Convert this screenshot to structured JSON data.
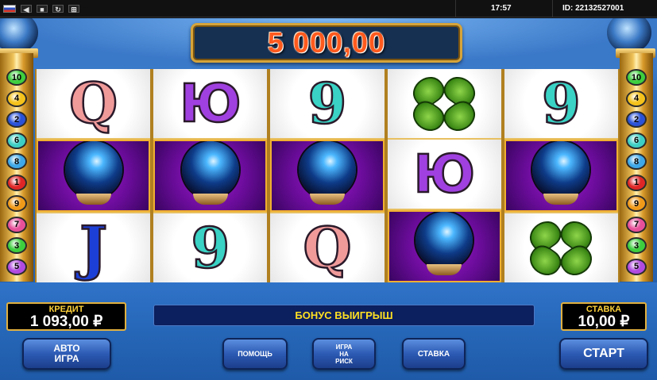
{
  "topbar": {
    "time": "17:57",
    "id_text": "ID: 22132527001",
    "icons": [
      "russia-flag-icon",
      "speaker-icon",
      "fullscreen-icon",
      "refresh-icon",
      "settings-icon"
    ]
  },
  "jackpot": {
    "value": "5 000,00"
  },
  "paylines_left": [
    {
      "num": "10",
      "color": "#3ecf3e"
    },
    {
      "num": "4",
      "color": "#f4c21a"
    },
    {
      "num": "2",
      "color": "#2a52d8"
    },
    {
      "num": "6",
      "color": "#3ecfc4"
    },
    {
      "num": "8",
      "color": "#3ea8e8"
    },
    {
      "num": "1",
      "color": "#e02626"
    },
    {
      "num": "9",
      "color": "#f09a1a"
    },
    {
      "num": "7",
      "color": "#e8509a"
    },
    {
      "num": "3",
      "color": "#3ecf3e"
    },
    {
      "num": "5",
      "color": "#b04ae0"
    }
  ],
  "paylines_right": [
    {
      "num": "10",
      "color": "#3ecf3e"
    },
    {
      "num": "4",
      "color": "#f4c21a"
    },
    {
      "num": "2",
      "color": "#2a52d8"
    },
    {
      "num": "6",
      "color": "#3ecfc4"
    },
    {
      "num": "8",
      "color": "#3ea8e8"
    },
    {
      "num": "1",
      "color": "#e02626"
    },
    {
      "num": "9",
      "color": "#f09a1a"
    },
    {
      "num": "7",
      "color": "#e8509a"
    },
    {
      "num": "3",
      "color": "#3ecf3e"
    },
    {
      "num": "5",
      "color": "#b04ae0"
    }
  ],
  "reels": [
    [
      "Q",
      "crystal-ball",
      "J"
    ],
    [
      "Ю",
      "crystal-ball",
      "9"
    ],
    [
      "9",
      "crystal-ball",
      "Q"
    ],
    [
      "clover",
      "Ю",
      "crystal-ball"
    ],
    [
      "9",
      "crystal-ball",
      "clover"
    ]
  ],
  "panel": {
    "credit_label": "КРЕДИТ",
    "credit_value": "1 093,00 ₽",
    "bonus_text": "БОНУС ВЫИГРЫШ",
    "stake_label": "СТАВКА",
    "stake_value": "10,00 ₽"
  },
  "buttons": {
    "auto_line1": "АВТО",
    "auto_line2": "ИГРА",
    "help": "ПОМОЩЬ",
    "risk_line1": "ИГРА",
    "risk_line2": "НА",
    "risk_line3": "РИСК",
    "stake": "СТАВКА",
    "start": "СТАРТ"
  }
}
